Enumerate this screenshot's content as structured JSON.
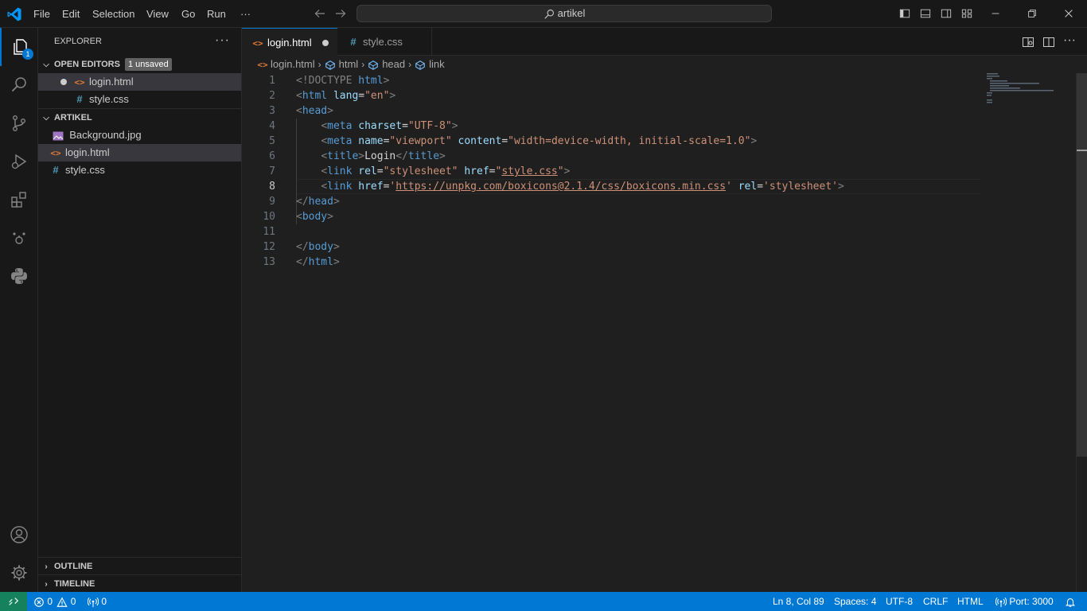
{
  "titlebar": {
    "menus": [
      "File",
      "Edit",
      "Selection",
      "View",
      "Go",
      "Run"
    ],
    "more": "···",
    "search_text": "artikel"
  },
  "activity_bar": {
    "explorer_badge": "1"
  },
  "sidebar": {
    "title": "EXPLORER",
    "more": "···",
    "open_editors": {
      "label": "OPEN EDITORS",
      "badge": "1 unsaved",
      "files": [
        "login.html",
        "style.css"
      ]
    },
    "folder": {
      "label": "ARTIKEL",
      "files": [
        "Background.jpg",
        "login.html",
        "style.css"
      ]
    },
    "outline_label": "OUTLINE",
    "timeline_label": "TIMELINE"
  },
  "tabs": [
    {
      "label": "login.html",
      "icon": "html-icon"
    },
    {
      "label": "style.css",
      "icon": "css-icon"
    }
  ],
  "breadcrumb": [
    "login.html",
    "html",
    "head",
    "link"
  ],
  "editor": {
    "line_numbers": [
      "1",
      "2",
      "3",
      "4",
      "5",
      "6",
      "7",
      "8",
      "9",
      "10",
      "11",
      "12",
      "13"
    ],
    "current_line": 8,
    "lines": [
      [
        [
          "t-br",
          "<!DOCTYPE "
        ],
        [
          "t-tag",
          "html"
        ],
        [
          "t-br",
          ">"
        ]
      ],
      [
        [
          "t-br",
          "<"
        ],
        [
          "t-tag",
          "html"
        ],
        [
          "t-txt",
          " "
        ],
        [
          "t-attr",
          "lang"
        ],
        [
          "t-txt",
          "="
        ],
        [
          "t-str",
          "\"en\""
        ],
        [
          "t-br",
          ">"
        ]
      ],
      [
        [
          "t-br",
          "<"
        ],
        [
          "t-tag",
          "head"
        ],
        [
          "t-br",
          ">"
        ]
      ],
      [
        [
          "t-txt",
          "    "
        ],
        [
          "t-br",
          "<"
        ],
        [
          "t-tag",
          "meta"
        ],
        [
          "t-txt",
          " "
        ],
        [
          "t-attr",
          "charset"
        ],
        [
          "t-txt",
          "="
        ],
        [
          "t-str",
          "\"UTF-8\""
        ],
        [
          "t-br",
          ">"
        ]
      ],
      [
        [
          "t-txt",
          "    "
        ],
        [
          "t-br",
          "<"
        ],
        [
          "t-tag",
          "meta"
        ],
        [
          "t-txt",
          " "
        ],
        [
          "t-attr",
          "name"
        ],
        [
          "t-txt",
          "="
        ],
        [
          "t-str",
          "\"viewport\""
        ],
        [
          "t-txt",
          " "
        ],
        [
          "t-attr",
          "content"
        ],
        [
          "t-txt",
          "="
        ],
        [
          "t-str",
          "\"width=device-width, initial-scale=1.0\""
        ],
        [
          "t-br",
          ">"
        ]
      ],
      [
        [
          "t-txt",
          "    "
        ],
        [
          "t-br",
          "<"
        ],
        [
          "t-tag",
          "title"
        ],
        [
          "t-br",
          ">"
        ],
        [
          "t-txt",
          "Login"
        ],
        [
          "t-br",
          "</"
        ],
        [
          "t-tag",
          "title"
        ],
        [
          "t-br",
          ">"
        ]
      ],
      [
        [
          "t-txt",
          "    "
        ],
        [
          "t-br",
          "<"
        ],
        [
          "t-tag",
          "link"
        ],
        [
          "t-txt",
          " "
        ],
        [
          "t-attr",
          "rel"
        ],
        [
          "t-txt",
          "="
        ],
        [
          "t-str",
          "\"stylesheet\""
        ],
        [
          "t-txt",
          " "
        ],
        [
          "t-attr",
          "href"
        ],
        [
          "t-txt",
          "="
        ],
        [
          "t-str",
          "\""
        ],
        [
          "t-url",
          "style.css"
        ],
        [
          "t-str",
          "\""
        ],
        [
          "t-br",
          ">"
        ]
      ],
      [
        [
          "t-txt",
          "    "
        ],
        [
          "t-br",
          "<"
        ],
        [
          "t-tag",
          "link"
        ],
        [
          "t-txt",
          " "
        ],
        [
          "t-attr",
          "href"
        ],
        [
          "t-txt",
          "="
        ],
        [
          "t-str",
          "'"
        ],
        [
          "t-url",
          "https://unpkg.com/boxicons@2.1.4/css/boxicons.min.css"
        ],
        [
          "t-str",
          "'"
        ],
        [
          "t-txt",
          " "
        ],
        [
          "t-attr",
          "rel"
        ],
        [
          "t-txt",
          "="
        ],
        [
          "t-str",
          "'stylesheet'"
        ],
        [
          "t-br",
          ">"
        ]
      ],
      [
        [
          "t-br",
          "</"
        ],
        [
          "t-tag",
          "head"
        ],
        [
          "t-br",
          ">"
        ]
      ],
      [
        [
          "t-br",
          "<"
        ],
        [
          "t-tag",
          "body"
        ],
        [
          "t-br",
          ">"
        ]
      ],
      [],
      [
        [
          "t-br",
          "</"
        ],
        [
          "t-tag",
          "body"
        ],
        [
          "t-br",
          ">"
        ]
      ],
      [
        [
          "t-br",
          "</"
        ],
        [
          "t-tag",
          "html"
        ],
        [
          "t-br",
          ">"
        ]
      ]
    ]
  },
  "status": {
    "errors": "0",
    "warnings": "0",
    "ports_forwarded": "0",
    "position": "Ln 8, Col 89",
    "spaces": "Spaces: 4",
    "encoding": "UTF-8",
    "eol": "CRLF",
    "language": "HTML",
    "port": "Port: 3000"
  },
  "colors": {
    "accent": "#0078d4",
    "statusbar": "#0078d4",
    "remote": "#16825d",
    "html_icon": "#e37933",
    "css_icon": "#519aba"
  }
}
